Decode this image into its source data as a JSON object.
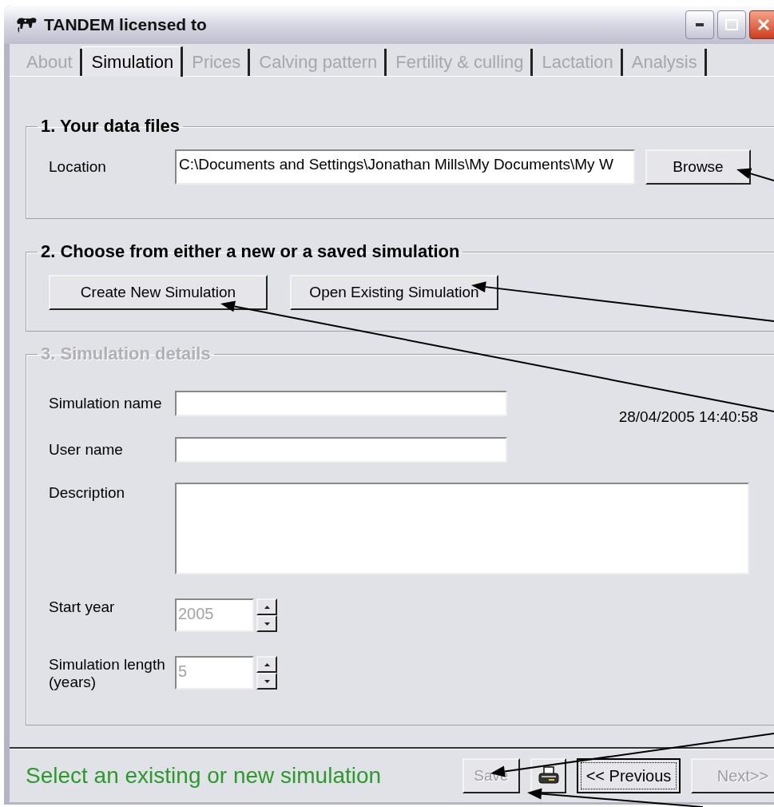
{
  "window": {
    "title": "TANDEM licensed to"
  },
  "tabs": [
    {
      "label": "About",
      "selected": false,
      "disabled": true
    },
    {
      "label": "Simulation",
      "selected": true,
      "disabled": false
    },
    {
      "label": "Prices",
      "selected": false,
      "disabled": true
    },
    {
      "label": "Calving pattern",
      "selected": false,
      "disabled": true
    },
    {
      "label": "Fertility & culling",
      "selected": false,
      "disabled": true
    },
    {
      "label": "Lactation",
      "selected": false,
      "disabled": true
    },
    {
      "label": "Analysis",
      "selected": false,
      "disabled": true
    }
  ],
  "data_files": {
    "title": "1. Your data files",
    "location_label": "Location",
    "location_value": "C:\\Documents and Settings\\Jonathan Mills\\My Documents\\My W",
    "browse_button": "Browse"
  },
  "simulation_choice": {
    "title": "2. Choose from either a new or a saved simulation",
    "buttons": [
      "Create New Simulation",
      "Open Existing Simulation"
    ]
  },
  "details": {
    "title": "3. Simulation details",
    "disabled": true,
    "timestamp": "28/04/2005 14:40:58",
    "fields": [
      {
        "kind": "text",
        "label": "Simulation name"
      },
      {
        "kind": "text",
        "label": "User name"
      },
      {
        "kind": "textarea",
        "label": "Description"
      },
      {
        "kind": "spinner",
        "label": "Start year",
        "value": "2005",
        "disabled": true
      },
      {
        "kind": "spinner",
        "label": "Simulation length (years)",
        "value": "5",
        "disabled": true
      }
    ]
  },
  "status_bar": {
    "message": "Select an existing or new simulation",
    "buttons": [
      {
        "kind": "save",
        "label": "Save",
        "disabled": true,
        "focused": false
      },
      {
        "kind": "print",
        "focused": false
      },
      {
        "kind": "previous",
        "label": "<< Previous",
        "disabled": false,
        "focused": true
      },
      {
        "kind": "next",
        "label": "Next>>",
        "disabled": true,
        "focused": false
      }
    ]
  }
}
